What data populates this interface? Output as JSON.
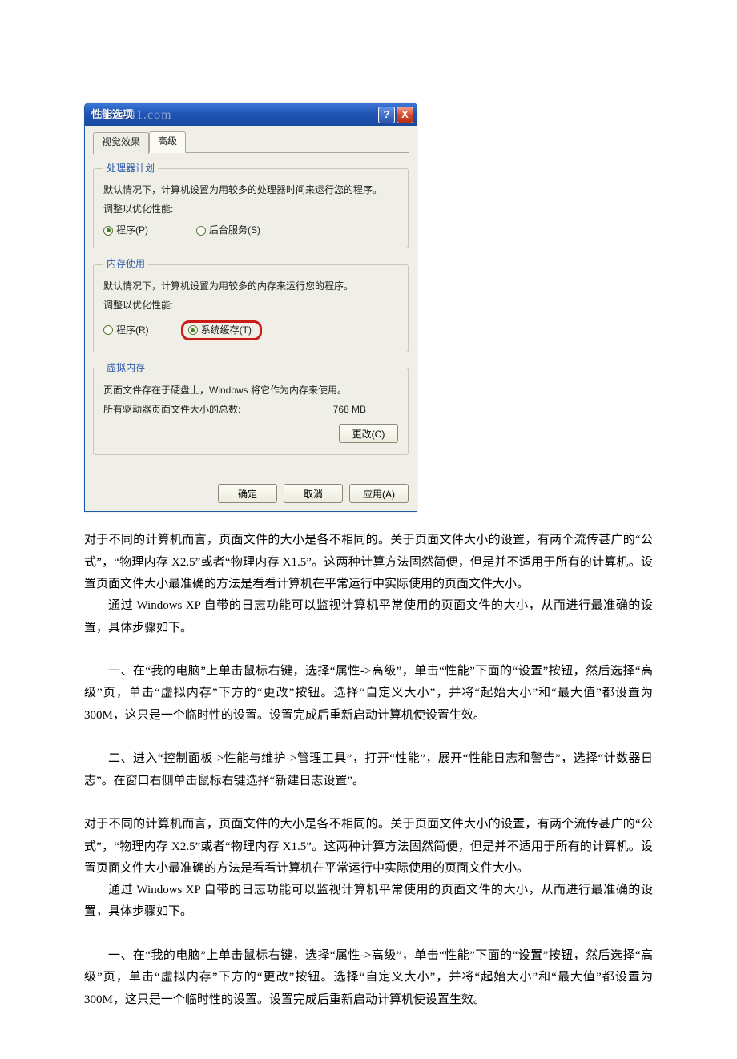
{
  "dialog": {
    "title": "性能选项",
    "watermark": "3871041.com",
    "help_tooltip": "?",
    "close_tooltip": "X",
    "tabs": {
      "visual": "视觉效果",
      "advanced": "高级"
    },
    "cpu_group": {
      "legend": "处理器计划",
      "desc": "默认情况下，计算机设置为用较多的处理器时间来运行您的程序。",
      "adjust_label": "调整以优化性能:",
      "opt_programs": "程序(P)",
      "opt_background": "后台服务(S)"
    },
    "mem_group": {
      "legend": "内存使用",
      "desc": "默认情况下，计算机设置为用较多的内存来运行您的程序。",
      "adjust_label": "调整以优化性能:",
      "opt_programs": "程序(R)",
      "opt_syscache": "系统缓存(T)"
    },
    "vm_group": {
      "legend": "虚拟内存",
      "desc": "页面文件存在于硬盘上，Windows 将它作为内存来使用。",
      "total_label": "所有驱动器页面文件大小的总数:",
      "total_value": "768 MB",
      "change_btn": "更改(C)"
    },
    "footer": {
      "ok": "确定",
      "cancel": "取消",
      "apply": "应用(A)"
    }
  },
  "article": {
    "p1": "对于不同的计算机而言，页面文件的大小是各不相同的。关于页面文件大小的设置，有两个流传甚广的“公式”，“物理内存 X2.5”或者“物理内存 X1.5”。这两种计算方法固然简便，但是并不适用于所有的计算机。设置页面文件大小最准确的方法是看看计算机在平常运行中实际使用的页面文件大小。",
    "p2": "通过 Windows XP 自带的日志功能可以监视计算机平常使用的页面文件的大小，从而进行最准确的设置，具体步骤如下。",
    "p3": "一、在“我的电脑”上单击鼠标右键，选择“属性->高级”，单击“性能”下面的“设置”按钮，然后选择“高级”页，单击“虚拟内存”下方的“更改”按钮。选择“自定义大小”，并将“起始大小”和“最大值”都设置为 300M，这只是一个临时性的设置。设置完成后重新启动计算机使设置生效。",
    "p4": "二、进入“控制面板->性能与维护->管理工具”，打开“性能”，展开“性能日志和警告”，选择“计数器日志”。在窗口右侧单击鼠标右键选择“新建日志设置”。",
    "p5": "对于不同的计算机而言，页面文件的大小是各不相同的。关于页面文件大小的设置，有两个流传甚广的“公式”，“物理内存 X2.5”或者“物理内存 X1.5”。这两种计算方法固然简便，但是并不适用于所有的计算机。设置页面文件大小最准确的方法是看看计算机在平常运行中实际使用的页面文件大小。",
    "p6": "通过 Windows XP 自带的日志功能可以监视计算机平常使用的页面文件的大小，从而进行最准确的设置，具体步骤如下。",
    "p7": "一、在“我的电脑”上单击鼠标右键，选择“属性->高级”，单击“性能”下面的“设置”按钮，然后选择“高级”页，单击“虚拟内存”下方的“更改”按钮。选择“自定义大小”，并将“起始大小”和“最大值”都设置为 300M，这只是一个临时性的设置。设置完成后重新启动计算机使设置生效。"
  }
}
